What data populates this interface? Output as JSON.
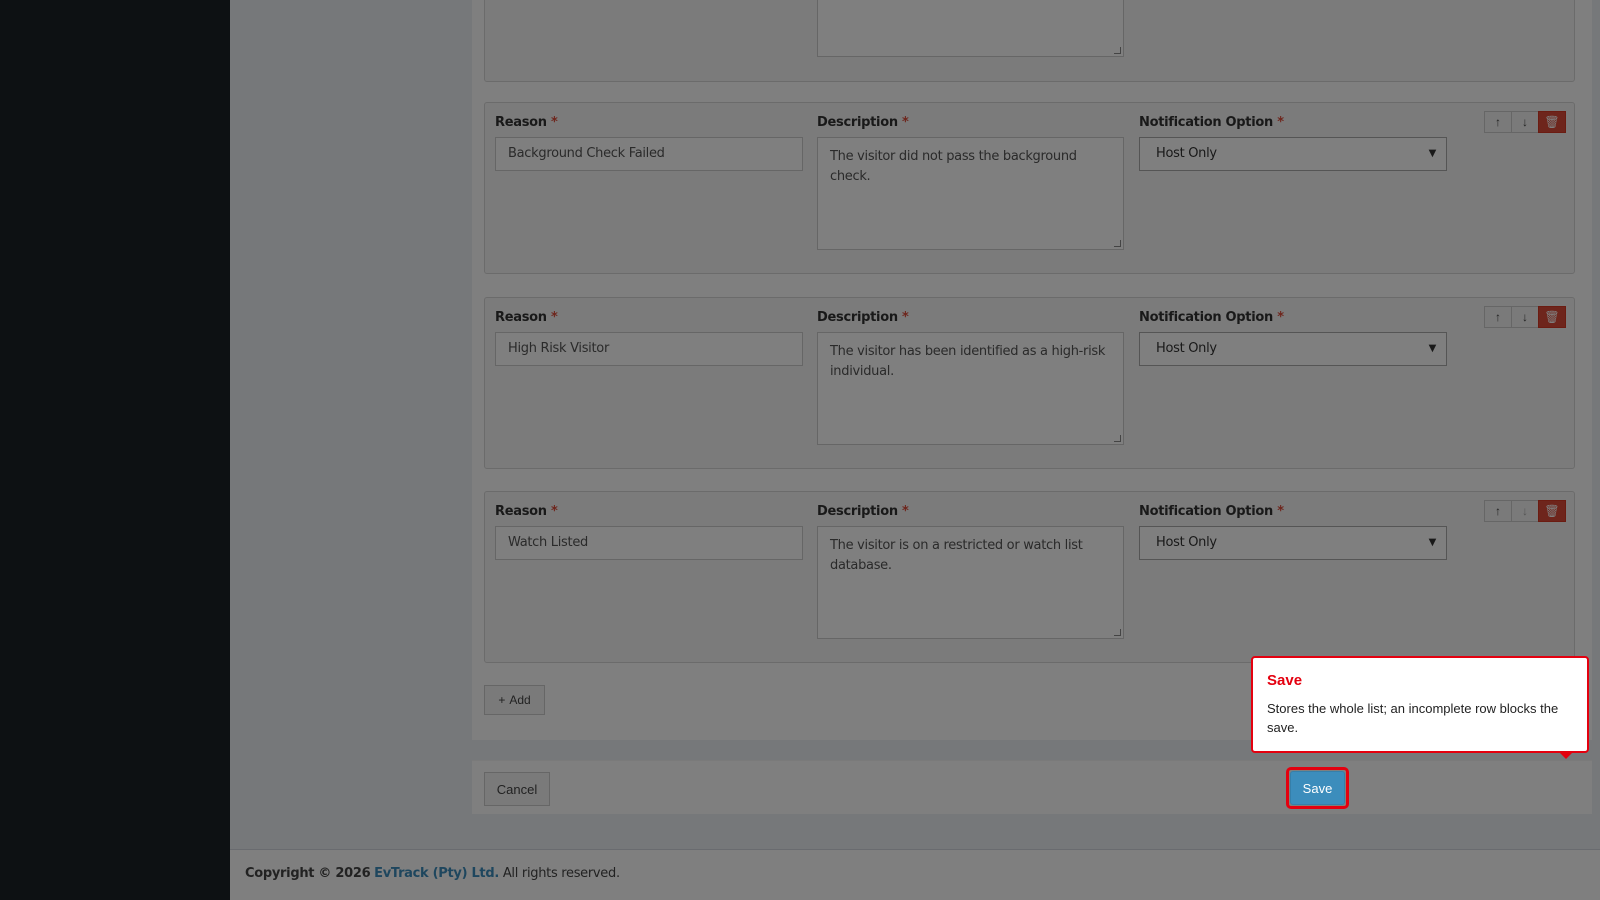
{
  "rows": [
    {
      "reason_label": "Reason",
      "reason_value": "Background Check Failed",
      "description_label": "Description",
      "description_value": "The visitor did not pass the background check.",
      "notification_label": "Notification Option",
      "notification_value": "Host Only"
    },
    {
      "reason_label": "Reason",
      "reason_value": "High Risk Visitor",
      "description_label": "Description",
      "description_value": "The visitor has been identified as a high-risk individual.",
      "notification_label": "Notification Option",
      "notification_value": "Host Only"
    },
    {
      "reason_label": "Reason",
      "reason_value": "Watch Listed",
      "description_label": "Description",
      "description_value": "The visitor is on a restricted or watch list database.",
      "notification_label": "Notification Option",
      "notification_value": "Host Only"
    }
  ],
  "required_marker": "*",
  "add_button": "Add",
  "cancel_button": "Cancel",
  "save_button": "Save",
  "tooltip": {
    "title": "Save",
    "body": "Stores the whole list; an incomplete row blocks the save."
  },
  "footer": {
    "prefix": "Copyright © 2026",
    "brand": "EvTrack (Pty) Ltd.",
    "suffix": "All rights reserved."
  },
  "colors": {
    "primary": "#3c8dbc",
    "danger": "#dd4b39",
    "highlight": "#e4000f",
    "sidebar": "#1a2226"
  }
}
